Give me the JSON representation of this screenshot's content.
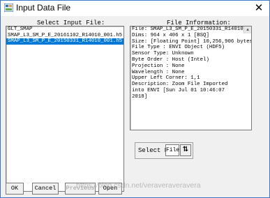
{
  "window": {
    "title": "Input Data File",
    "close_glyph": "✕"
  },
  "input_panel": {
    "label": "Select Input File:",
    "files": [
      {
        "name": "GLT_SMAP",
        "selected": false
      },
      {
        "name": "SMAP_L3_SM_P_E_20161102_R14010_001.h5",
        "selected": false
      },
      {
        "name": "SMAP_L3_SM_P_E_20150331_R14010_001.h5",
        "selected": true
      }
    ]
  },
  "info_panel": {
    "label": "File Information:",
    "lines": [
      "File: SMAP_L3_SM_P_E_20150331_R14010_001.h5",
      "Dims: 964 x 406 x 1 [BSQ]",
      "Size: [Floating Point] 10,256,906 bytes.",
      "File Type  : ENVI Object (HDF5)",
      "Sensor Type: Unknown",
      "Byte Order : Host (Intel)",
      "Projection : None",
      "Wavelength : None",
      "Upper Left Corner: 1,1",
      "Description: Zoom File Imported",
      "into ENVI [Sun Jul 01 10:46:07",
      "2018]"
    ]
  },
  "select_by": {
    "label": "Select By",
    "value": "File",
    "sort_icon": "sort-arrows-icon"
  },
  "buttons": {
    "ok": "OK",
    "cancel": "Cancel",
    "previous": "Previous",
    "open": "Open"
  },
  "watermark": "https://blog.csdn.net/veraveraveravera"
}
